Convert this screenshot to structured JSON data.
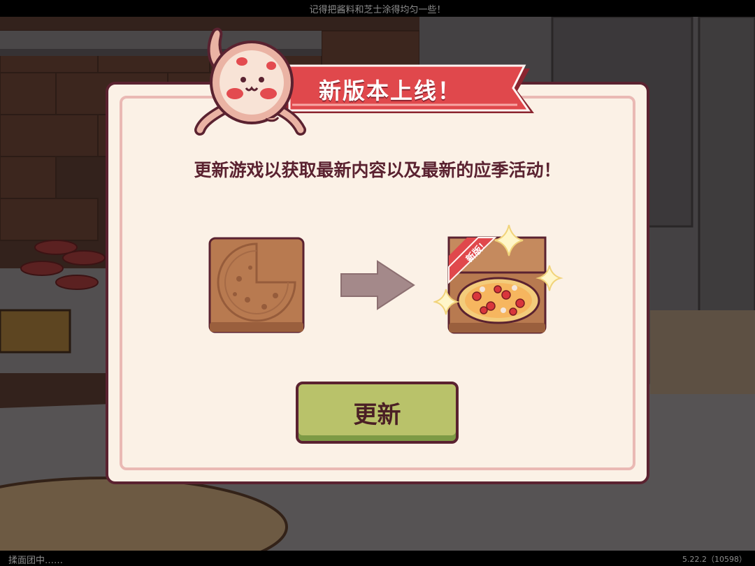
{
  "top_bar": {
    "hint": "记得把酱料和芝士涂得均匀一些！"
  },
  "bottom_bar": {
    "status": "揉面团中……",
    "version": "5.22.2（10598）"
  },
  "dialog": {
    "title": "新版本上线！",
    "message": "更新游戏以获取最新内容以及最新的应季活动！",
    "new_badge": "新版！",
    "update_button_label": "更新"
  },
  "colors": {
    "modal_bg": "#fbf1e6",
    "modal_border": "#5a2230",
    "ribbon": "#e0484c",
    "button": "#b9c26a",
    "pizza_box": "#b87a50"
  },
  "icons": [
    "pizza-mascot-icon",
    "empty-pizza-box-icon",
    "right-arrow-icon",
    "pizza-box-new-icon",
    "sparkle-icon"
  ]
}
